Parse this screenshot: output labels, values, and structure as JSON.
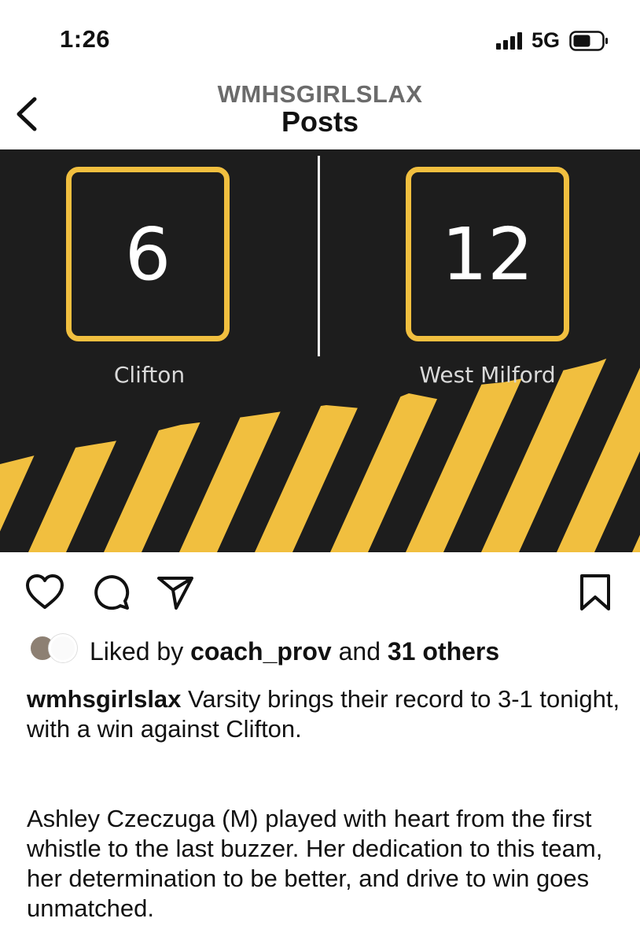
{
  "status_bar": {
    "time": "1:26",
    "network": "5G"
  },
  "nav": {
    "account": "WMHSGIRLSLAX",
    "title": "Posts"
  },
  "post": {
    "home_team": {
      "name": "Clifton",
      "score": "6"
    },
    "away_team": {
      "name": "West Milford",
      "score": "12"
    },
    "colors": {
      "accent": "#f1bf3f",
      "background": "#1d1d1d"
    }
  },
  "actions": {
    "like_icon": "heart-icon",
    "comment_icon": "comment-icon",
    "share_icon": "share-icon",
    "save_icon": "bookmark-icon"
  },
  "likes": {
    "prefix": "Liked by ",
    "user": "coach_prov",
    "middle": " and ",
    "others": "31 others"
  },
  "caption": {
    "username": "wmhsgirlslax",
    "first": " Varsity brings their record to 3-1 tonight, with a win against Clifton.",
    "second": "Ashley Czeczuga (M) played with heart from the first whistle to the last buzzer. Her dedication to this team, her determination to be better, and drive to win goes unmatched."
  }
}
